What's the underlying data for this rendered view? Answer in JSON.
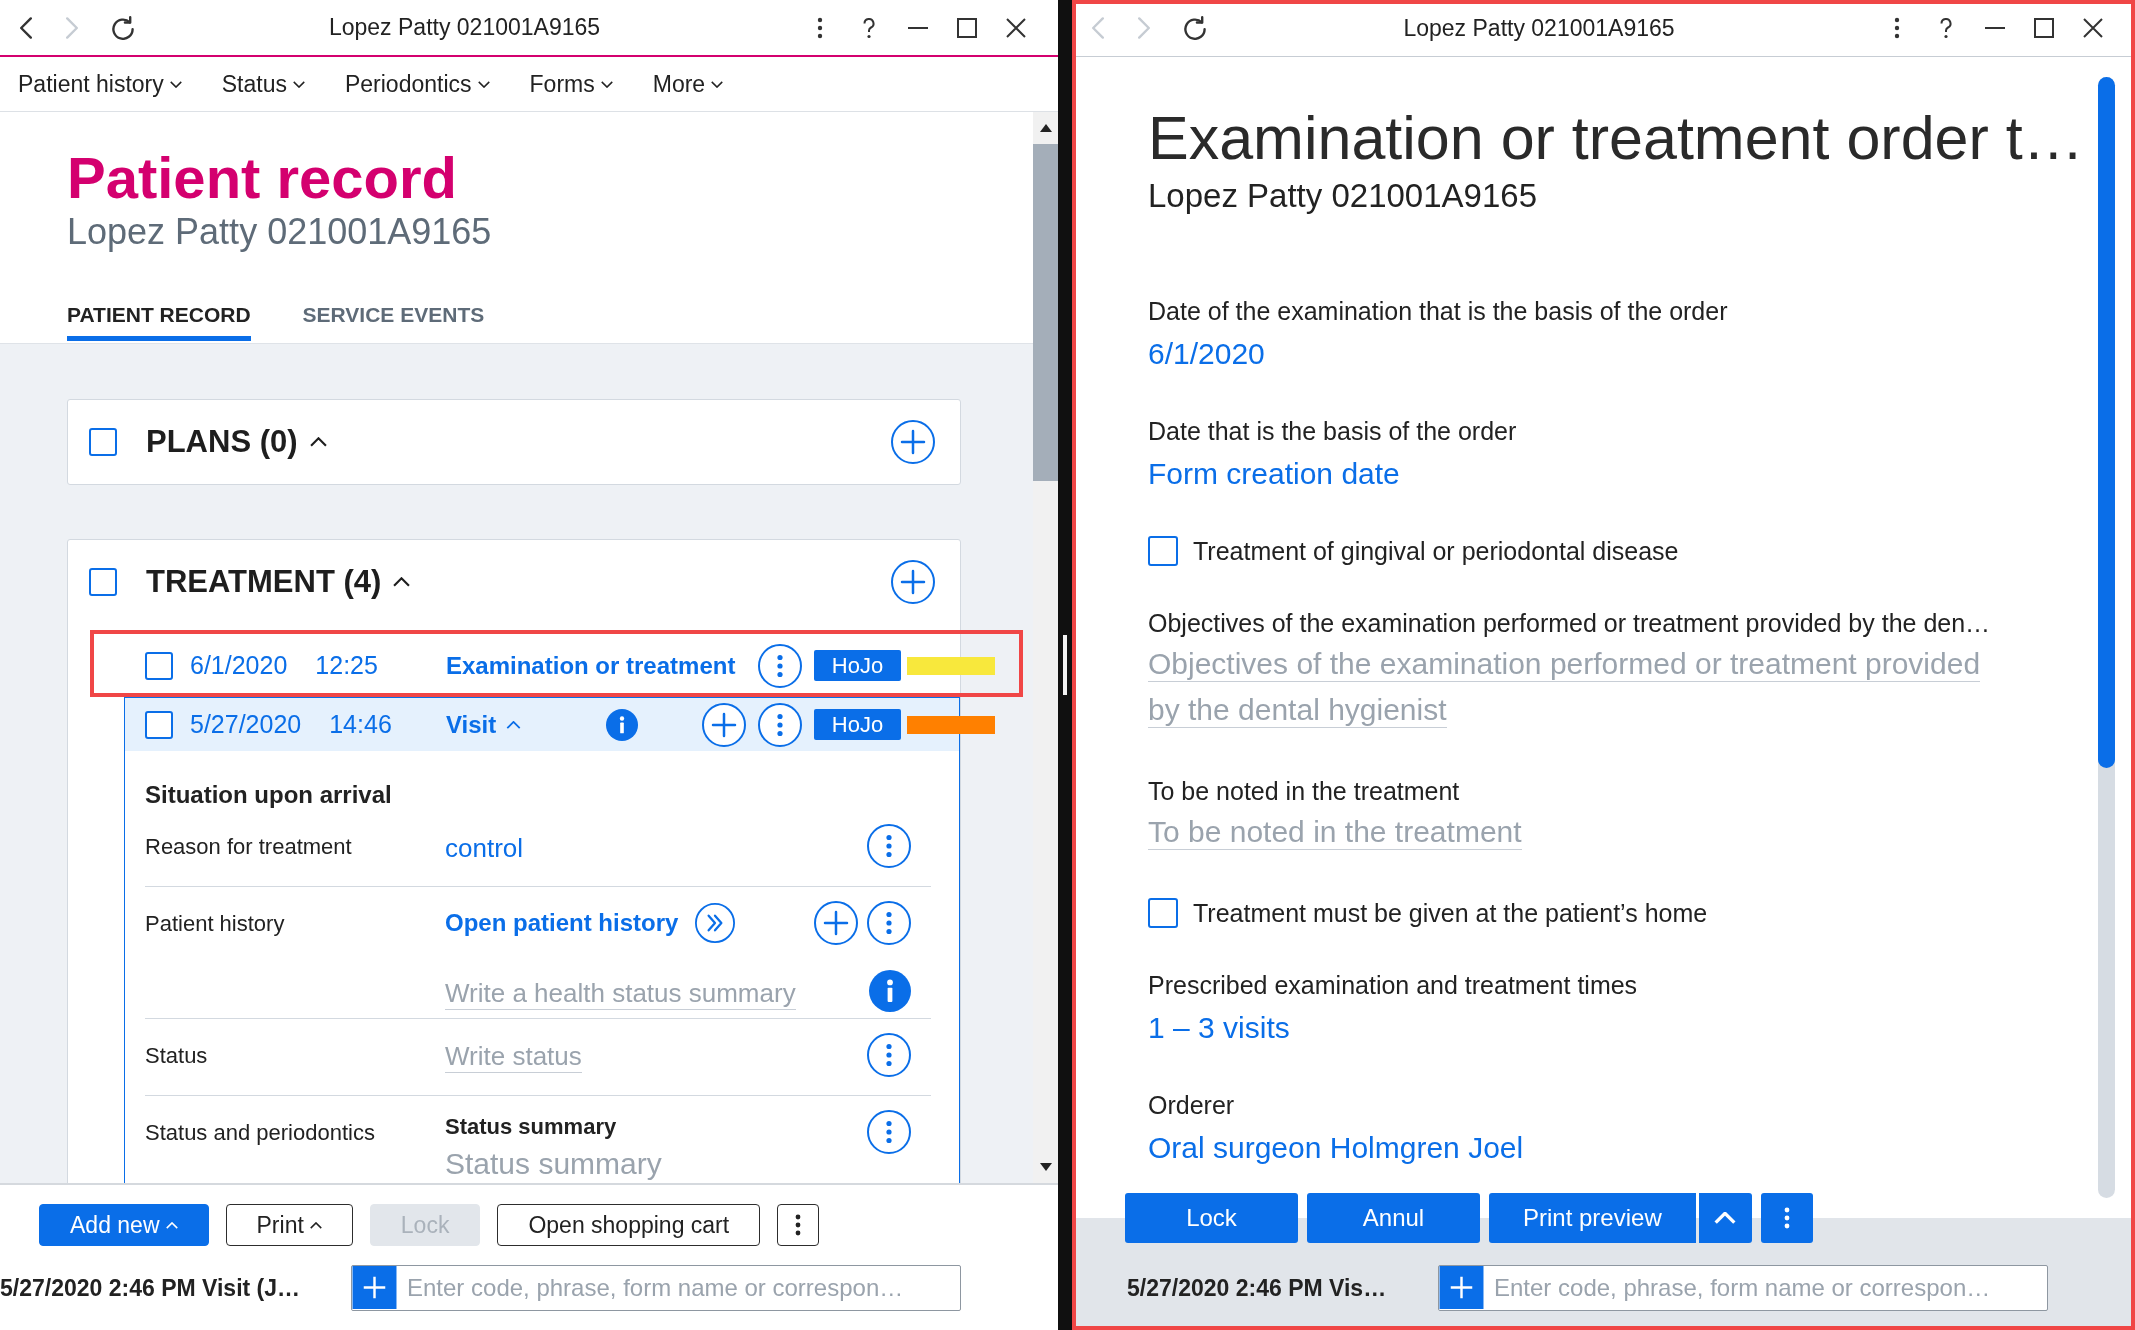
{
  "left_window": {
    "title": "Lopez Patty 021001A9165",
    "nav_buttons": [
      {
        "kind": "back",
        "disabled": false
      },
      {
        "kind": "forward",
        "disabled": true
      },
      {
        "kind": "refresh",
        "disabled": false
      }
    ],
    "menu": [
      {
        "label": "Patient history"
      },
      {
        "label": "Status"
      },
      {
        "label": "Periodontics"
      },
      {
        "label": "Forms"
      },
      {
        "label": "More"
      }
    ],
    "page_title": "Patient record",
    "page_subtitle": "Lopez Patty 021001A9165",
    "tabs": [
      {
        "label": "PATIENT RECORD",
        "selected": true
      },
      {
        "label": "SERVICE EVENTS",
        "selected": false
      }
    ],
    "sections": [
      {
        "title": "PLANS (0)",
        "checked": false,
        "expanded": true
      },
      {
        "title": "TREATMENT (4)",
        "checked": false,
        "expanded": true,
        "rows": [
          {
            "kind": "form",
            "date": "6/1/2020",
            "time": "12:25",
            "title": "Examination or treatment",
            "checked": false,
            "highlighted": true,
            "author": "HoJo",
            "color": "#f8e83c"
          },
          {
            "kind": "visit",
            "date": "5/27/2020",
            "time": "14:46",
            "title": "Visit",
            "checked": false,
            "highlighted": false,
            "expanded": true,
            "author": "HoJo",
            "color": "#ff8000",
            "details": {
              "heading": "Situation upon arrival",
              "fields": [
                {
                  "kind": "value",
                  "label": "Reason for treatment",
                  "value": "control"
                },
                {
                  "kind": "history",
                  "label": "Patient history",
                  "link": "Open patient history",
                  "placeholder": "Write a health status summary"
                },
                {
                  "kind": "text",
                  "label": "Status",
                  "placeholder": "Write status"
                },
                {
                  "kind": "summary",
                  "label": "Status and periodontics",
                  "heading": "Status summary",
                  "placeholder": "Status summary"
                }
              ]
            }
          }
        ]
      }
    ],
    "footer_buttons": [
      {
        "kind": "primary",
        "label": "Add new",
        "has_menu": true,
        "disabled": false
      },
      {
        "kind": "outline",
        "label": "Print",
        "has_menu": true,
        "disabled": false
      },
      {
        "kind": "outline",
        "label": "Lock",
        "has_menu": false,
        "disabled": true
      },
      {
        "kind": "outline",
        "label": "Open shopping cart",
        "has_menu": false,
        "disabled": false
      },
      {
        "kind": "more",
        "disabled": false
      }
    ],
    "status_text": "5/27/2020 2:46 PM Visit (J…",
    "command_placeholder": "Enter code, phrase, form name or correspon…"
  },
  "right_window": {
    "title": "Lopez Patty 021001A9165",
    "highlighted": true,
    "nav_buttons": [
      {
        "kind": "back",
        "disabled": true
      },
      {
        "kind": "forward",
        "disabled": true
      },
      {
        "kind": "refresh",
        "disabled": false
      }
    ],
    "heading": "Examination or treatment order t…",
    "subtitle": "Lopez Patty 021001A9165",
    "fields": [
      {
        "kind": "link",
        "label": "Date of the examination that is the basis of the order",
        "value": "6/1/2020"
      },
      {
        "kind": "link",
        "label": "Date that is the basis of the order",
        "value": "Form creation date"
      },
      {
        "kind": "checkbox",
        "label": "Treatment of gingival or periodontal disease",
        "checked": false
      },
      {
        "kind": "textarea",
        "label": "Objectives of the examination performed or treatment provided by the den…",
        "placeholder": "Objectives of the examination performed or treatment provided by the dental hygienist"
      },
      {
        "kind": "textarea",
        "label": "To be noted in the treatment",
        "placeholder": "To be noted in the treatment"
      },
      {
        "kind": "checkbox",
        "label": "Treatment must be given at the patient’s home",
        "checked": false
      },
      {
        "kind": "link",
        "label": "Prescribed examination and treatment times",
        "value": "1 – 3 visits"
      },
      {
        "kind": "link",
        "label": "Orderer",
        "value": "Oral surgeon Holmgren Joel"
      }
    ],
    "buttons": [
      {
        "kind": "primary",
        "label": "Lock"
      },
      {
        "kind": "primary",
        "label": "Annul"
      },
      {
        "kind": "split",
        "label": "Print preview"
      },
      {
        "kind": "more"
      }
    ],
    "status_text": "5/27/2020 2:46 PM Vis…",
    "command_placeholder": "Enter code, phrase, form name or correspon…"
  }
}
